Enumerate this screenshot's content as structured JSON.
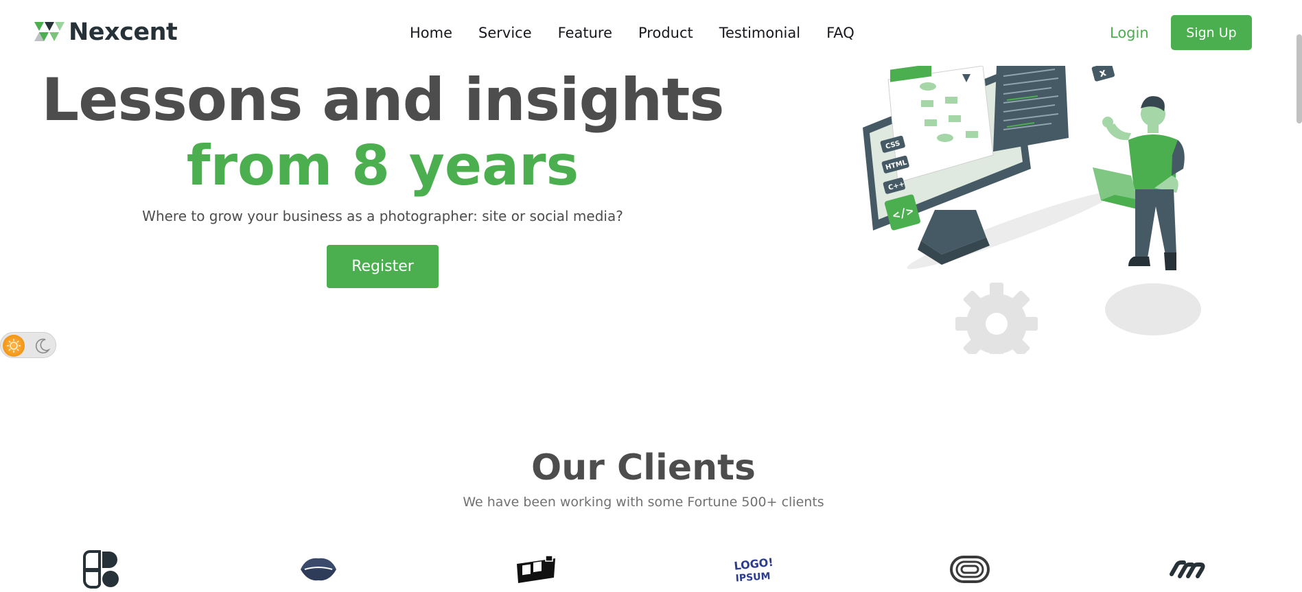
{
  "brand": {
    "name": "Nexcent",
    "logo_icon": "nexcent-triangles-logo-icon",
    "primary_color": "#4CAF4F",
    "dark_color": "#263238"
  },
  "nav": {
    "items": [
      {
        "label": "Home"
      },
      {
        "label": "Service"
      },
      {
        "label": "Feature"
      },
      {
        "label": "Product"
      },
      {
        "label": "Testimonial"
      },
      {
        "label": "FAQ"
      }
    ],
    "login_label": "Login",
    "signup_label": "Sign Up"
  },
  "hero": {
    "title_line1": "Lessons and insights",
    "title_line2": "from 8 years",
    "subtitle": "Where to grow your business as a photographer: site or social media?",
    "register_label": "Register",
    "illustration": "developer-with-laptop-and-monitor-illustration"
  },
  "theme_toggle": {
    "light_icon": "sun-icon",
    "dark_icon": "moon-icon",
    "mode": "light"
  },
  "clients": {
    "title": "Our Clients",
    "subtitle": "We have been working with some Fortune 500+ clients",
    "logos": [
      {
        "icon": "client-logo-1-icon"
      },
      {
        "icon": "client-logo-2-icon"
      },
      {
        "icon": "client-logo-3-icon"
      },
      {
        "icon": "client-logo-4-icon",
        "text": "LOGO IPSUM"
      },
      {
        "icon": "client-logo-5-icon"
      },
      {
        "icon": "client-logo-6-icon"
      }
    ]
  }
}
